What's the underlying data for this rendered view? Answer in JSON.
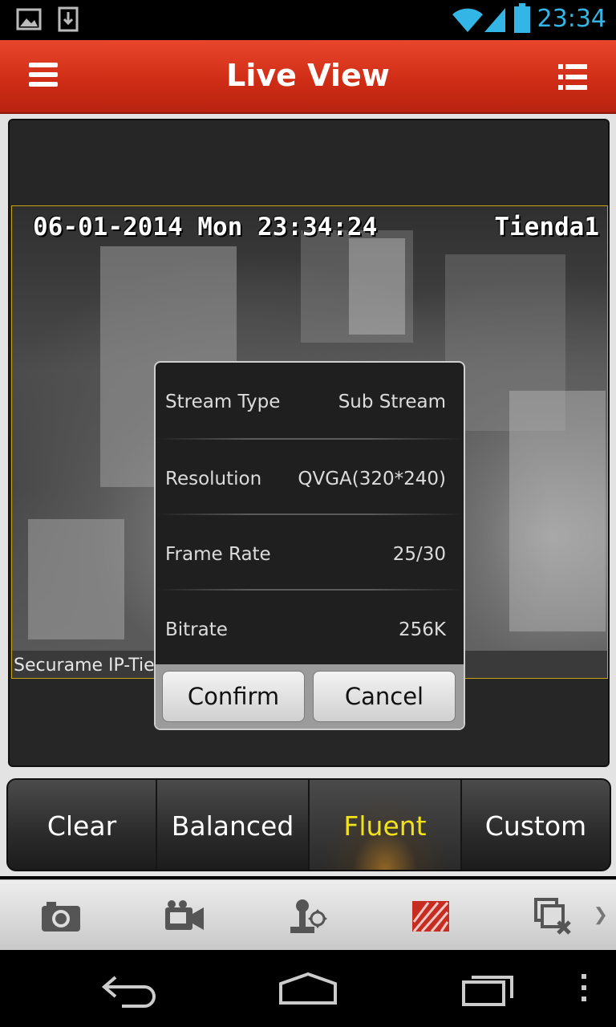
{
  "status_bar": {
    "time": "23:34",
    "icons": [
      "image-icon",
      "download-icon",
      "wifi-icon",
      "signal-icon",
      "battery-icon"
    ]
  },
  "app_bar": {
    "title": "Live View",
    "menu_icon": "hamburger-menu-icon",
    "list_icon": "list-view-icon"
  },
  "video": {
    "osd_datetime": "06-01-2014 Mon 23:34:24",
    "osd_camera": "Tienda1",
    "camera_label": "Securame IP-Tie"
  },
  "dialog": {
    "rows": [
      {
        "label": "Stream Type",
        "value": "Sub Stream"
      },
      {
        "label": "Resolution",
        "value": "QVGA(320*240)"
      },
      {
        "label": "Frame Rate",
        "value": "25/30"
      },
      {
        "label": "Bitrate",
        "value": "256K"
      }
    ],
    "confirm_label": "Confirm",
    "cancel_label": "Cancel"
  },
  "quality": {
    "options": [
      "Clear",
      "Balanced",
      "Fluent",
      "Custom"
    ],
    "selected": "Fluent",
    "active_color": "#f0e31d"
  },
  "toolbar": {
    "icons": [
      "camera-icon",
      "video-record-icon",
      "ptz-joystick-icon",
      "quality-icon",
      "close-windows-icon"
    ],
    "active_icon": "quality-icon",
    "active_color": "#c62c22"
  },
  "nav_bar": {
    "icons": [
      "back-icon",
      "home-icon",
      "recent-apps-icon",
      "overflow-menu-icon"
    ]
  },
  "colors": {
    "app_bar": "#d02d16",
    "status_time": "#33b5e5"
  }
}
